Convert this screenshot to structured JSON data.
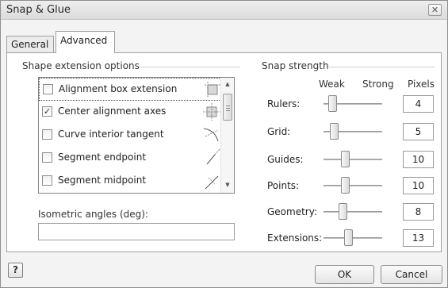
{
  "window": {
    "title": "Snap & Glue",
    "close_glyph": "✕"
  },
  "tabs": [
    {
      "label": "General",
      "active": false
    },
    {
      "label": "Advanced",
      "active": true
    }
  ],
  "shape_extension": {
    "label": "Shape extension options",
    "items": [
      {
        "label": "Alignment box extension",
        "checked": false,
        "icon": "alignment-box-extension-icon"
      },
      {
        "label": "Center alignment axes",
        "checked": true,
        "icon": "center-alignment-axes-icon"
      },
      {
        "label": "Curve interior tangent",
        "checked": false,
        "icon": "curve-interior-tangent-icon"
      },
      {
        "label": "Segment endpoint",
        "checked": false,
        "icon": "segment-endpoint-icon"
      },
      {
        "label": "Segment midpoint",
        "checked": false,
        "icon": "segment-midpoint-icon"
      }
    ]
  },
  "isometric": {
    "label": "Isometric angles (deg):",
    "value": ""
  },
  "snap_strength": {
    "label": "Snap strength",
    "headers": {
      "weak": "Weak",
      "strong": "Strong",
      "pixels": "Pixels"
    },
    "rows": [
      {
        "label": "Rulers:",
        "pixels": "4"
      },
      {
        "label": "Grid:",
        "pixels": "5"
      },
      {
        "label": "Guides:",
        "pixels": "10"
      },
      {
        "label": "Points:",
        "pixels": "10"
      },
      {
        "label": "Geometry:",
        "pixels": "8"
      },
      {
        "label": "Extensions:",
        "pixels": "13"
      }
    ]
  },
  "buttons": {
    "help": "?",
    "ok": "OK",
    "cancel": "Cancel"
  },
  "colors": {
    "accent": "#4a7bd0",
    "check": "#333333"
  }
}
